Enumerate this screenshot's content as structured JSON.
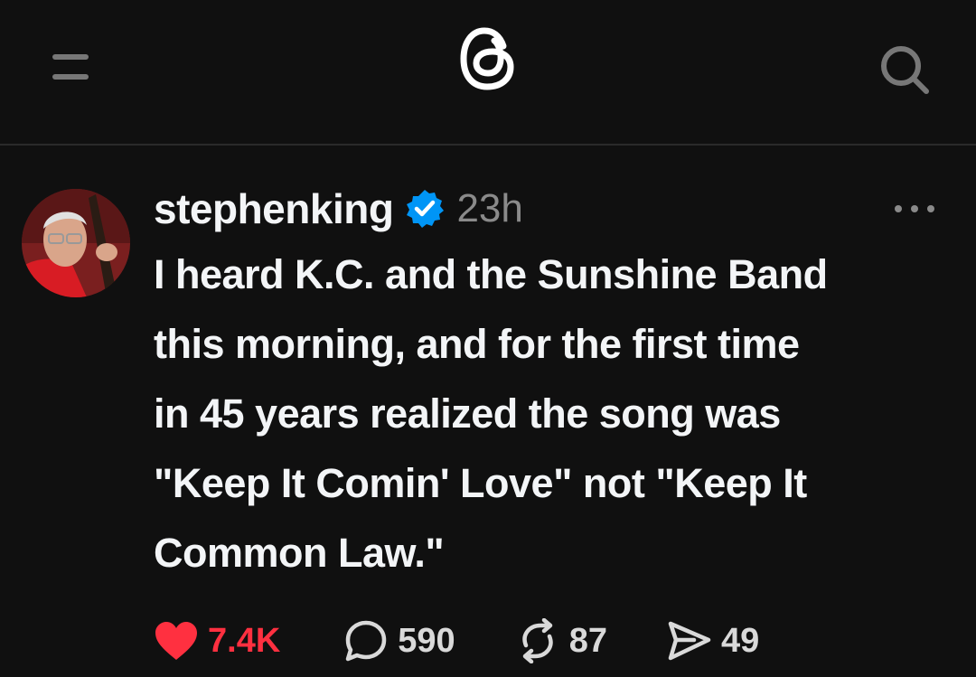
{
  "header": {
    "menu_icon": "hamburger-menu-icon",
    "logo_icon": "threads-logo-icon",
    "search_icon": "search-icon"
  },
  "post": {
    "username": "stephenking",
    "verified": true,
    "timestamp": "23h",
    "text_lines": [
      "I heard K.C. and the Sunshine Band",
      "this morning, and for the first time",
      "in 45 years realized the song was",
      "\"Keep It Comin' Love\" not \"Keep It",
      "Common Law.\""
    ],
    "actions": {
      "likes": "7.4K",
      "replies": "590",
      "reposts": "87",
      "shares": "49"
    }
  },
  "colors": {
    "background": "#101010",
    "text": "#f3f5f7",
    "muted": "#8a8a8a",
    "like": "#ff3040",
    "verified": "#0095f6"
  }
}
